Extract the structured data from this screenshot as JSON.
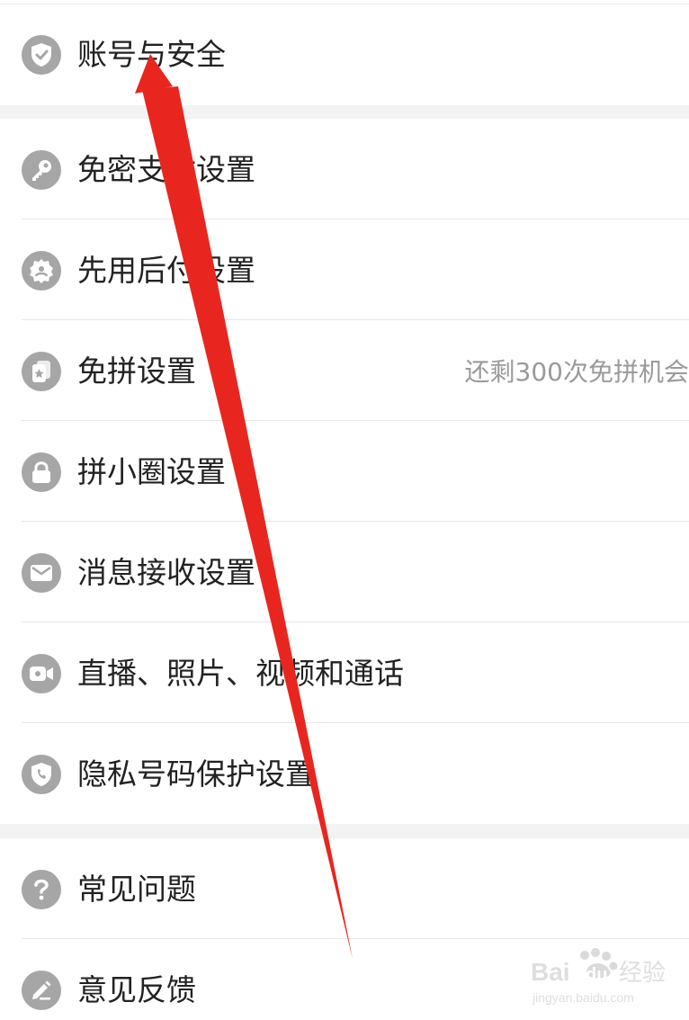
{
  "settings": {
    "group1": {
      "account_security": {
        "label": "账号与安全",
        "icon": "shield-check-icon"
      }
    },
    "group2": {
      "secret_free_pay": {
        "label": "免密支付设置",
        "icon": "key-icon"
      },
      "pay_later": {
        "label": "先用后付设置",
        "icon": "badge-person-icon"
      },
      "free_group": {
        "label": "免拼设置",
        "icon": "card-star-icon",
        "value": "还剩300次免拼机会"
      },
      "pin_circle": {
        "label": "拼小圈设置",
        "icon": "lock-icon"
      },
      "message_receive": {
        "label": "消息接收设置",
        "icon": "mail-icon"
      },
      "live_photo_video": {
        "label": "直播、照片、视频和通话",
        "icon": "video-camera-icon"
      },
      "privacy_number": {
        "label": "隐私号码保护设置",
        "icon": "shield-phone-icon"
      }
    },
    "group3": {
      "faq": {
        "label": "常见问题",
        "icon": "question-icon"
      },
      "feedback": {
        "label": "意见反馈",
        "icon": "pencil-icon"
      }
    }
  },
  "colors": {
    "icon_bg": "#a6a6a6",
    "arrow": "#e8261f",
    "text": "#222222",
    "value_text": "#9a9a9a"
  },
  "watermark": {
    "brand": "Bai",
    "brand_du": "du",
    "product": "经验",
    "domain": "jingyan.baidu.com"
  }
}
